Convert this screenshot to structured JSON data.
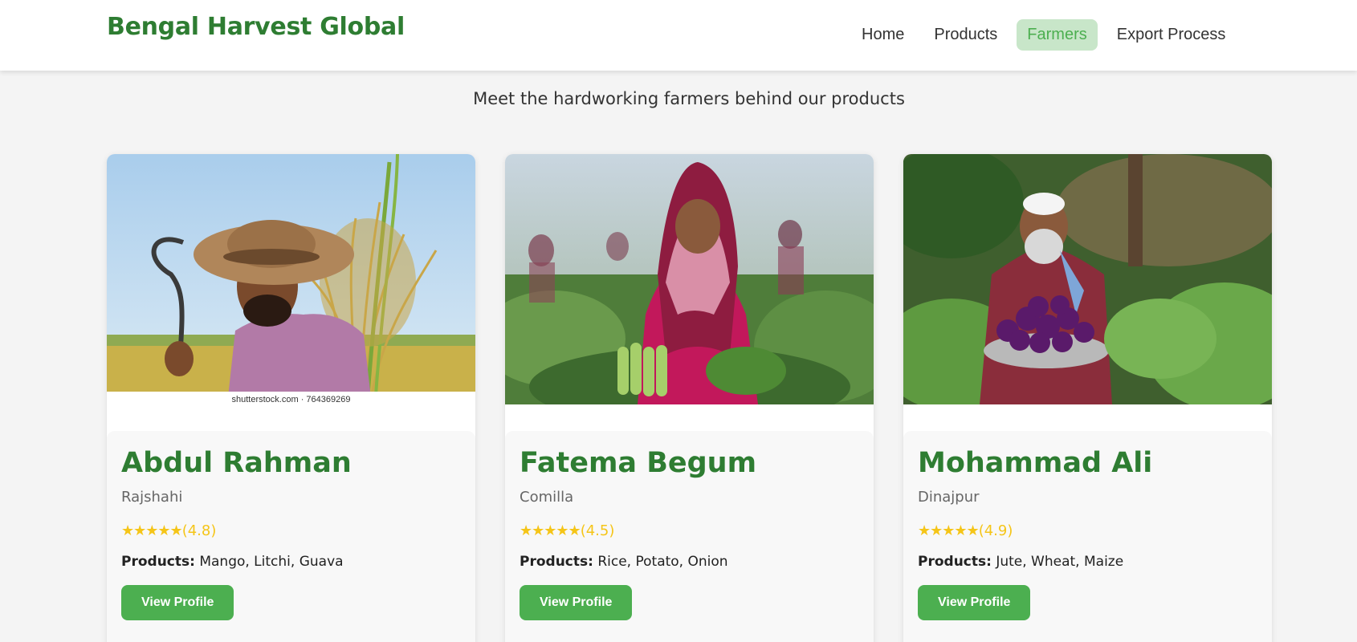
{
  "header": {
    "brand": "Bengal Harvest Global",
    "nav": [
      {
        "label": "Home",
        "active": false
      },
      {
        "label": "Products",
        "active": false
      },
      {
        "label": "Farmers",
        "active": true
      },
      {
        "label": "Export Process",
        "active": false
      }
    ]
  },
  "subtitle": "Meet the hardworking farmers behind our products",
  "farmers": [
    {
      "name": "Abdul Rahman",
      "region": "Rajshahi",
      "stars": "★★★★★",
      "rating": "(4.8)",
      "products_label": "Products:",
      "products": "Mango, Litchi, Guava",
      "button": "View Profile",
      "watermark": "shutterstock.com · 764369269"
    },
    {
      "name": "Fatema Begum",
      "region": "Comilla",
      "stars": "★★★★★",
      "rating": "(4.5)",
      "products_label": "Products:",
      "products": "Rice, Potato, Onion",
      "button": "View Profile"
    },
    {
      "name": "Mohammad Ali",
      "region": "Dinajpur",
      "stars": "★★★★★",
      "rating": "(4.9)",
      "products_label": "Products:",
      "products": "Jute, Wheat, Maize",
      "button": "View Profile"
    }
  ],
  "colors": {
    "brand_green": "#2e7d32",
    "button_green": "#4caf50",
    "active_nav_bg": "#c8e6c9",
    "star_gold": "#f5c518",
    "page_bg": "#f4f4f4"
  }
}
